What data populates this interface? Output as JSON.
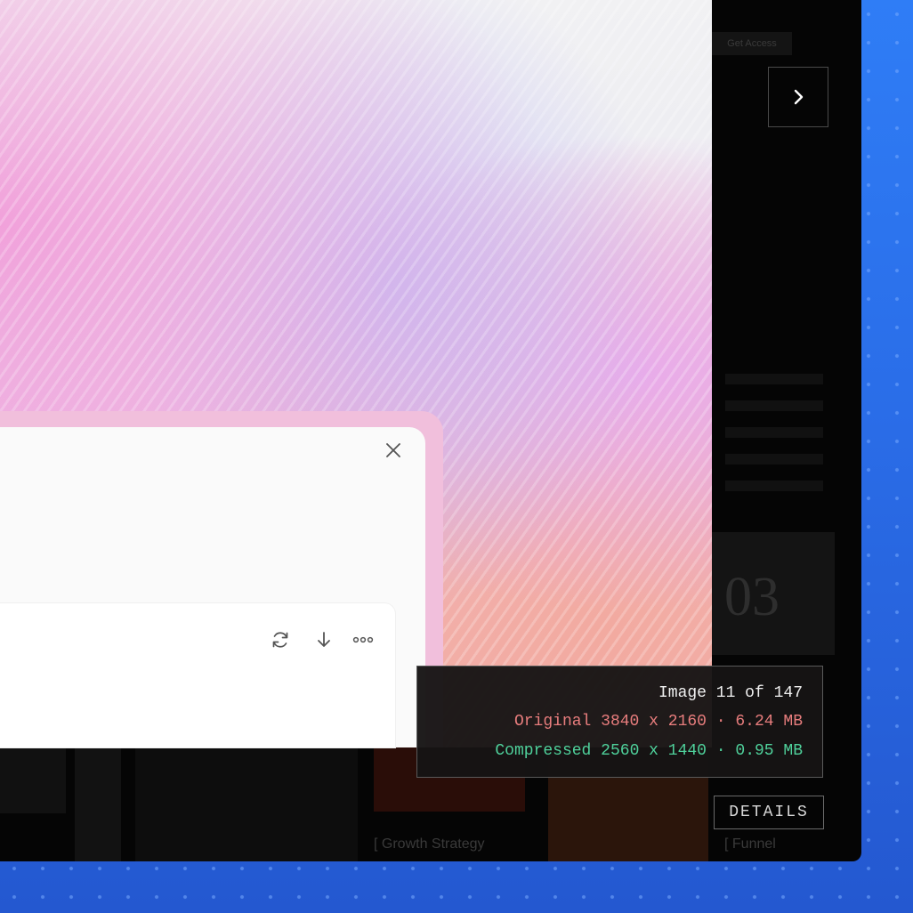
{
  "header": {
    "get_access_label": "Get Access"
  },
  "gallery": {
    "card_number": "03",
    "bottom_labels": [
      "[ Growth Strategy",
      "[ Funnel"
    ]
  },
  "info_overlay": {
    "position_line": "Image 11 of 147",
    "original_line": "Original 3840 x 2160 · 6.24 MB",
    "compressed_line": "Compressed 2560 x 1440 · 0.95 MB",
    "original_color": "#e87d7d",
    "compressed_color": "#4fd19b",
    "position_color": "#f0f0f0"
  },
  "details_button": {
    "label": "DETAILS"
  },
  "icons": {
    "next": "chevron-right-icon",
    "close": "close-icon",
    "regenerate": "refresh-icon",
    "download": "download-icon",
    "more": "more-horizontal-icon"
  }
}
